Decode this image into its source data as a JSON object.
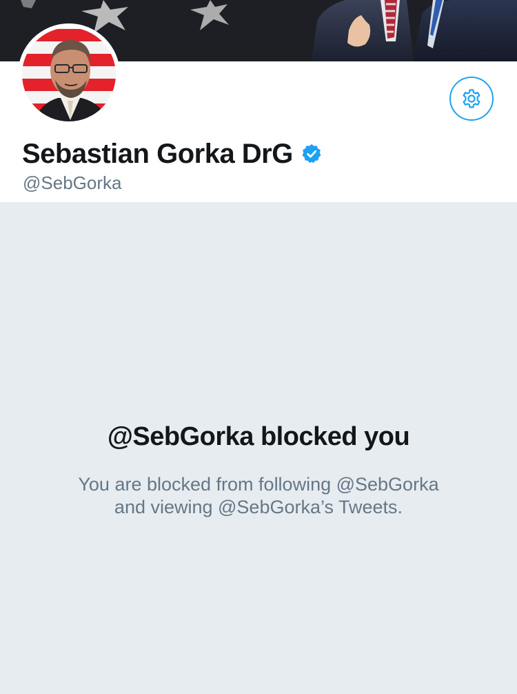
{
  "profile": {
    "display_name": "Sebastian Gorka DrG",
    "handle": "@SebGorka",
    "verified": true,
    "avatar_icon": "profile-photo",
    "settings_icon": "gear-icon"
  },
  "blocked_notice": {
    "title": "@SebGorka blocked you",
    "body_line1": "You are blocked from following @SebGorka",
    "body_line2": "and viewing @SebGorka’s Tweets."
  },
  "colors": {
    "accent": "#1da1f2",
    "text_primary": "#14171a",
    "text_secondary": "#657786",
    "background": "#e6ecf0"
  }
}
